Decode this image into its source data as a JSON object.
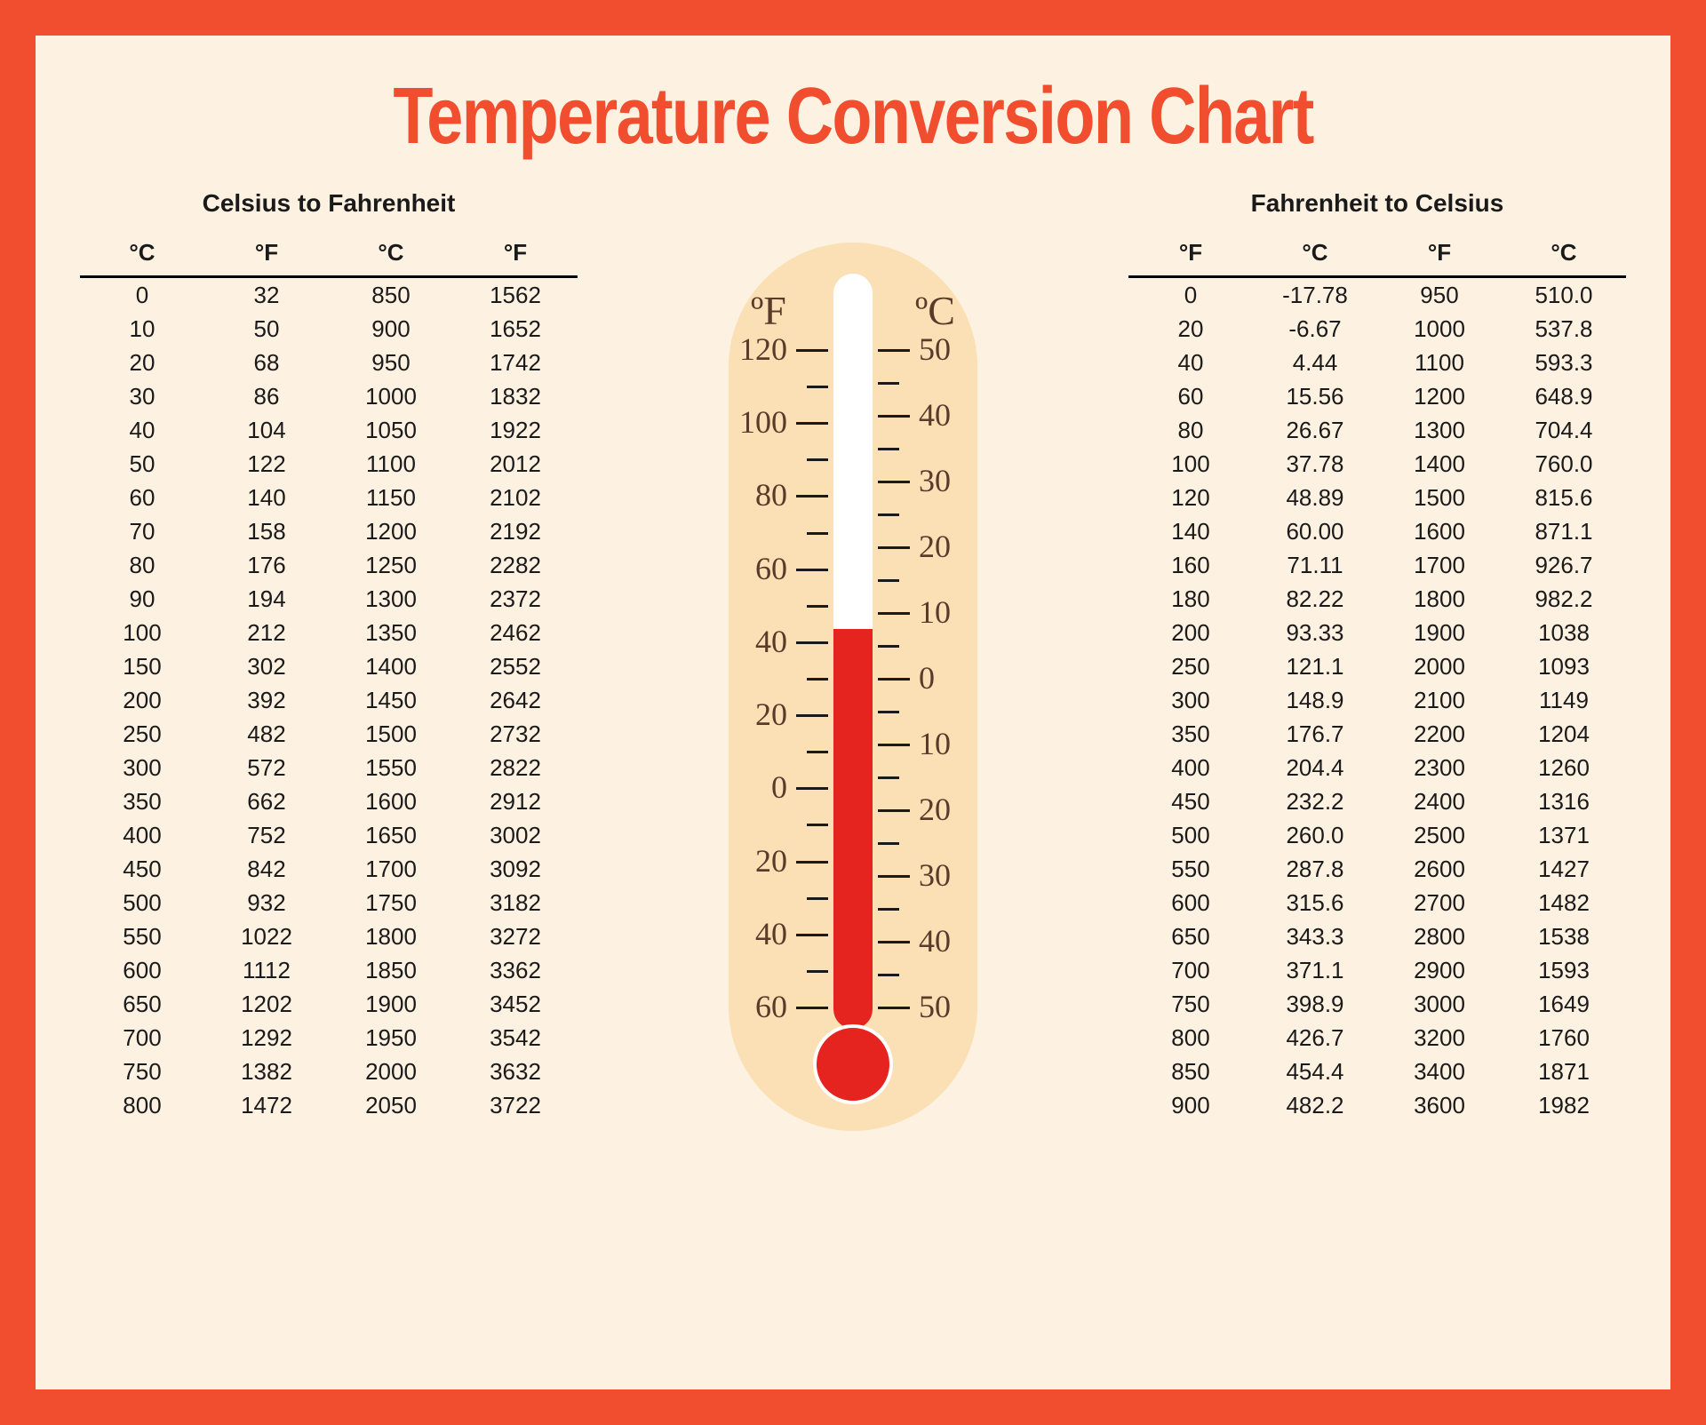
{
  "title": "Temperature Conversion Chart",
  "left": {
    "heading": "Celsius to Fahrenheit",
    "headers": [
      "°C",
      "°F",
      "°C",
      "°F"
    ],
    "rows": [
      [
        "0",
        "32",
        "850",
        "1562"
      ],
      [
        "10",
        "50",
        "900",
        "1652"
      ],
      [
        "20",
        "68",
        "950",
        "1742"
      ],
      [
        "30",
        "86",
        "1000",
        "1832"
      ],
      [
        "40",
        "104",
        "1050",
        "1922"
      ],
      [
        "50",
        "122",
        "1100",
        "2012"
      ],
      [
        "60",
        "140",
        "1150",
        "2102"
      ],
      [
        "70",
        "158",
        "1200",
        "2192"
      ],
      [
        "80",
        "176",
        "1250",
        "2282"
      ],
      [
        "90",
        "194",
        "1300",
        "2372"
      ],
      [
        "100",
        "212",
        "1350",
        "2462"
      ],
      [
        "150",
        "302",
        "1400",
        "2552"
      ],
      [
        "200",
        "392",
        "1450",
        "2642"
      ],
      [
        "250",
        "482",
        "1500",
        "2732"
      ],
      [
        "300",
        "572",
        "1550",
        "2822"
      ],
      [
        "350",
        "662",
        "1600",
        "2912"
      ],
      [
        "400",
        "752",
        "1650",
        "3002"
      ],
      [
        "450",
        "842",
        "1700",
        "3092"
      ],
      [
        "500",
        "932",
        "1750",
        "3182"
      ],
      [
        "550",
        "1022",
        "1800",
        "3272"
      ],
      [
        "600",
        "1112",
        "1850",
        "3362"
      ],
      [
        "650",
        "1202",
        "1900",
        "3452"
      ],
      [
        "700",
        "1292",
        "1950",
        "3542"
      ],
      [
        "750",
        "1382",
        "2000",
        "3632"
      ],
      [
        "800",
        "1472",
        "2050",
        "3722"
      ]
    ]
  },
  "right": {
    "heading": "Fahrenheit to Celsius",
    "headers": [
      "°F",
      "°C",
      "°F",
      "°C"
    ],
    "rows": [
      [
        "0",
        "-17.78",
        "950",
        "510.0"
      ],
      [
        "20",
        "-6.67",
        "1000",
        "537.8"
      ],
      [
        "40",
        "4.44",
        "1100",
        "593.3"
      ],
      [
        "60",
        "15.56",
        "1200",
        "648.9"
      ],
      [
        "80",
        "26.67",
        "1300",
        "704.4"
      ],
      [
        "100",
        "37.78",
        "1400",
        "760.0"
      ],
      [
        "120",
        "48.89",
        "1500",
        "815.6"
      ],
      [
        "140",
        "60.00",
        "1600",
        "871.1"
      ],
      [
        "160",
        "71.11",
        "1700",
        "926.7"
      ],
      [
        "180",
        "82.22",
        "1800",
        "982.2"
      ],
      [
        "200",
        "93.33",
        "1900",
        "1038"
      ],
      [
        "250",
        "121.1",
        "2000",
        "1093"
      ],
      [
        "300",
        "148.9",
        "2100",
        "1149"
      ],
      [
        "350",
        "176.7",
        "2200",
        "1204"
      ],
      [
        "400",
        "204.4",
        "2300",
        "1260"
      ],
      [
        "450",
        "232.2",
        "2400",
        "1316"
      ],
      [
        "500",
        "260.0",
        "2500",
        "1371"
      ],
      [
        "550",
        "287.8",
        "2600",
        "1427"
      ],
      [
        "600",
        "315.6",
        "2700",
        "1482"
      ],
      [
        "650",
        "343.3",
        "2800",
        "1538"
      ],
      [
        "700",
        "371.1",
        "2900",
        "1593"
      ],
      [
        "750",
        "398.9",
        "3000",
        "1649"
      ],
      [
        "800",
        "426.7",
        "3200",
        "1760"
      ],
      [
        "850",
        "454.4",
        "3400",
        "1871"
      ],
      [
        "900",
        "482.2",
        "3600",
        "1982"
      ]
    ]
  },
  "thermo": {
    "f_label": "ºF",
    "c_label": "ºC",
    "f_scale": [
      "120",
      "100",
      "80",
      "60",
      "40",
      "20",
      "0",
      "20",
      "40",
      "60"
    ],
    "c_scale": [
      "50",
      "40",
      "30",
      "20",
      "10",
      "0",
      "10",
      "20",
      "30",
      "40",
      "50"
    ]
  },
  "chart_data": {
    "type": "table",
    "title": "Temperature Conversion Chart",
    "celsius_to_fahrenheit": {
      "columns": [
        "C",
        "F"
      ],
      "data": [
        [
          0,
          32
        ],
        [
          10,
          50
        ],
        [
          20,
          68
        ],
        [
          30,
          86
        ],
        [
          40,
          104
        ],
        [
          50,
          122
        ],
        [
          60,
          140
        ],
        [
          70,
          158
        ],
        [
          80,
          176
        ],
        [
          90,
          194
        ],
        [
          100,
          212
        ],
        [
          150,
          302
        ],
        [
          200,
          392
        ],
        [
          250,
          482
        ],
        [
          300,
          572
        ],
        [
          350,
          662
        ],
        [
          400,
          752
        ],
        [
          450,
          842
        ],
        [
          500,
          932
        ],
        [
          550,
          1022
        ],
        [
          600,
          1112
        ],
        [
          650,
          1202
        ],
        [
          700,
          1292
        ],
        [
          750,
          1382
        ],
        [
          800,
          1472
        ],
        [
          850,
          1562
        ],
        [
          900,
          1652
        ],
        [
          950,
          1742
        ],
        [
          1000,
          1832
        ],
        [
          1050,
          1922
        ],
        [
          1100,
          2012
        ],
        [
          1150,
          2102
        ],
        [
          1200,
          2192
        ],
        [
          1250,
          2282
        ],
        [
          1300,
          2372
        ],
        [
          1350,
          2462
        ],
        [
          1400,
          2552
        ],
        [
          1450,
          2642
        ],
        [
          1500,
          2732
        ],
        [
          1550,
          2822
        ],
        [
          1600,
          2912
        ],
        [
          1650,
          3002
        ],
        [
          1700,
          3092
        ],
        [
          1750,
          3182
        ],
        [
          1800,
          3272
        ],
        [
          1850,
          3362
        ],
        [
          1900,
          3452
        ],
        [
          1950,
          3542
        ],
        [
          2000,
          3632
        ],
        [
          2050,
          3722
        ]
      ]
    },
    "fahrenheit_to_celsius": {
      "columns": [
        "F",
        "C"
      ],
      "data": [
        [
          0,
          -17.78
        ],
        [
          20,
          -6.67
        ],
        [
          40,
          4.44
        ],
        [
          60,
          15.56
        ],
        [
          80,
          26.67
        ],
        [
          100,
          37.78
        ],
        [
          120,
          48.89
        ],
        [
          140,
          60.0
        ],
        [
          160,
          71.11
        ],
        [
          180,
          82.22
        ],
        [
          200,
          93.33
        ],
        [
          250,
          121.1
        ],
        [
          300,
          148.9
        ],
        [
          350,
          176.7
        ],
        [
          400,
          204.4
        ],
        [
          450,
          232.2
        ],
        [
          500,
          260.0
        ],
        [
          550,
          287.8
        ],
        [
          600,
          315.6
        ],
        [
          650,
          343.3
        ],
        [
          700,
          371.1
        ],
        [
          750,
          398.9
        ],
        [
          800,
          426.7
        ],
        [
          850,
          454.4
        ],
        [
          900,
          482.2
        ],
        [
          950,
          510.0
        ],
        [
          1000,
          537.8
        ],
        [
          1100,
          593.3
        ],
        [
          1200,
          648.9
        ],
        [
          1300,
          704.4
        ],
        [
          1400,
          760.0
        ],
        [
          1500,
          815.6
        ],
        [
          1600,
          871.1
        ],
        [
          1700,
          926.7
        ],
        [
          1800,
          982.2
        ],
        [
          1900,
          1038
        ],
        [
          2000,
          1093
        ],
        [
          2100,
          1149
        ],
        [
          2200,
          1204
        ],
        [
          2300,
          1260
        ],
        [
          2400,
          1316
        ],
        [
          2500,
          1371
        ],
        [
          2600,
          1427
        ],
        [
          2700,
          1482
        ],
        [
          2800,
          1538
        ],
        [
          2900,
          1593
        ],
        [
          3000,
          1649
        ],
        [
          3200,
          1760
        ],
        [
          3400,
          1871
        ],
        [
          3600,
          1982
        ]
      ]
    },
    "thermometer": {
      "f_range": [
        -60,
        120
      ],
      "c_range": [
        -50,
        50
      ],
      "reading_c": 0,
      "reading_f": 32
    }
  }
}
